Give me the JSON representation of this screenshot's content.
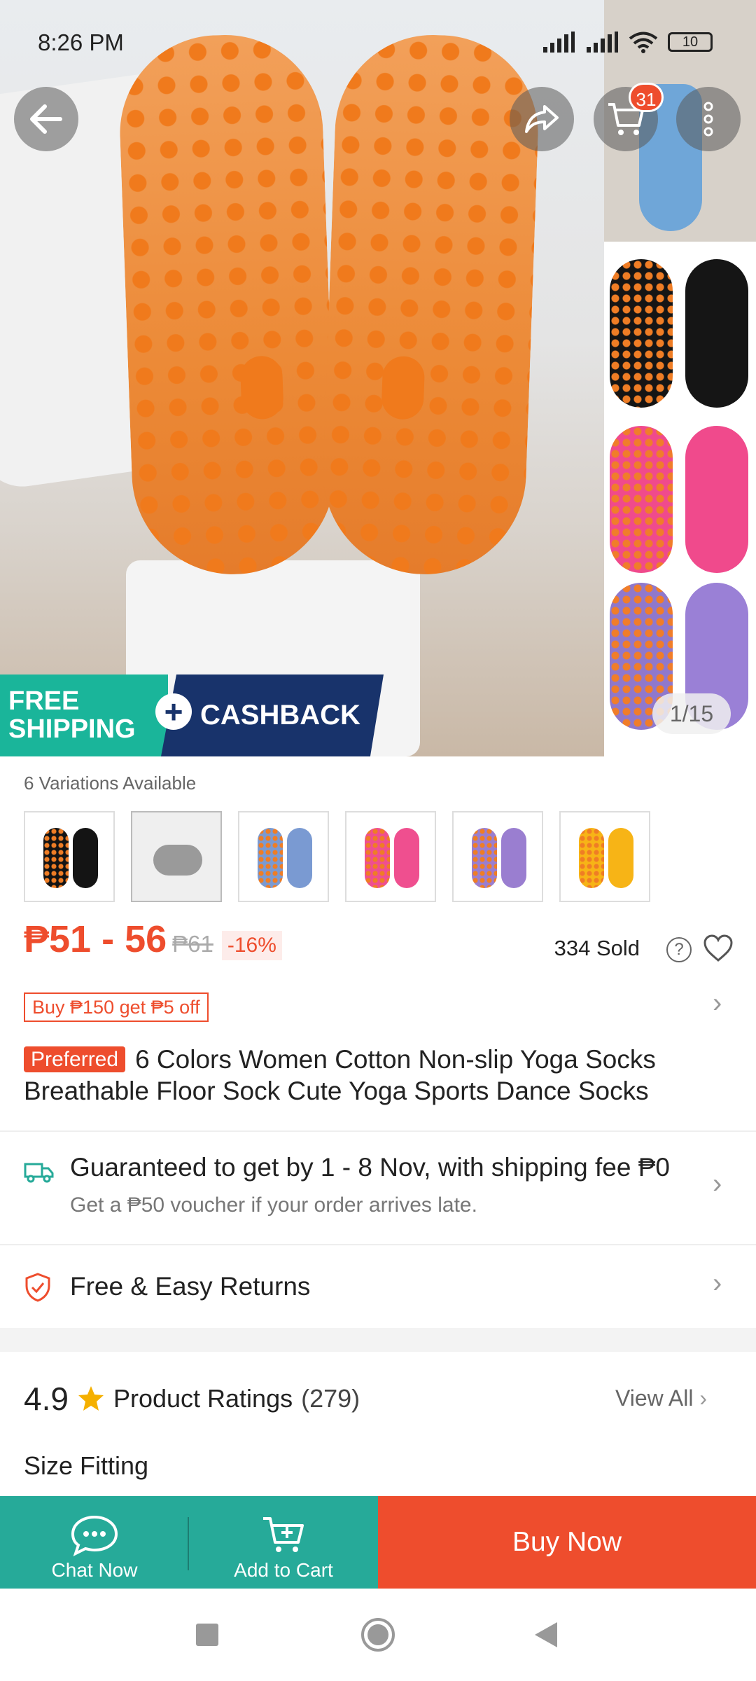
{
  "status_bar": {
    "time": "8:26 PM",
    "battery": "10"
  },
  "hero": {
    "banner_free": "FREE",
    "banner_shipping": "SHIPPING",
    "banner_cashback": "CASHBACK",
    "image_counter": "1/15",
    "cart_count": "31"
  },
  "variations": {
    "label": "6 Variations Available",
    "items": [
      {
        "name": "black",
        "color": "#141414"
      },
      {
        "name": "grey",
        "color": "#9a9a9a"
      },
      {
        "name": "blue",
        "color": "#7a9ad2"
      },
      {
        "name": "pink",
        "color": "#ef4f8f"
      },
      {
        "name": "purple",
        "color": "#9a7ed0"
      },
      {
        "name": "yellow",
        "color": "#f7b416"
      }
    ]
  },
  "price": {
    "range": "₱51 - 56",
    "original": "₱61",
    "discount": "-16%",
    "sold": "334 Sold"
  },
  "voucher": "Buy ₱150 get ₱5 off",
  "product": {
    "badge": "Preferred",
    "title": "6 Colors Women Cotton Non-slip Yoga Socks Breathable Floor Sock Cute Yoga Sports Dance Socks"
  },
  "shipping": {
    "title": "Guaranteed to get by 1 - 8 Nov, with shipping fee ₱0",
    "subtitle": "Get a ₱50 voucher if your order arrives late."
  },
  "returns": "Free & Easy Returns",
  "ratings": {
    "score": "4.9",
    "label": "Product Ratings",
    "count": "(279)",
    "view_all": "View All",
    "size_fitting": "Size Fitting"
  },
  "bottom_bar": {
    "chat": "Chat Now",
    "add_to_cart": "Add to Cart",
    "buy_now": "Buy Now"
  },
  "colors": {
    "accent": "#ee4d2d",
    "teal": "#26aa99",
    "orange_sock": "#ec8a37"
  }
}
